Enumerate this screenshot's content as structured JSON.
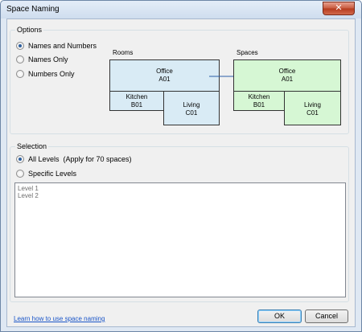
{
  "window": {
    "title": "Space Naming",
    "close_glyph": "✕"
  },
  "options": {
    "group_label": "Options",
    "radios": [
      {
        "label": "Names and Numbers",
        "checked": true
      },
      {
        "label": "Names Only",
        "checked": false
      },
      {
        "label": "Numbers Only",
        "checked": false
      }
    ]
  },
  "diagram": {
    "rooms_label": "Rooms",
    "spaces_label": "Spaces",
    "rooms": {
      "office": {
        "name": "Office",
        "number": "A01"
      },
      "kitchen": {
        "name": "Kitchen",
        "number": "B01"
      },
      "living": {
        "name": "Living",
        "number": "C01"
      }
    },
    "spaces": {
      "office": {
        "name": "Office",
        "number": "A01"
      },
      "kitchen": {
        "name": "Kitchen",
        "number": "B01"
      },
      "living": {
        "name": "Living",
        "number": "C01"
      }
    },
    "colors": {
      "room_fill": "#d9ebf5",
      "space_fill": "#d6f7d4",
      "arrow": "#2a5ea8"
    }
  },
  "selection": {
    "group_label": "Selection",
    "radios": [
      {
        "label": "All Levels  (Apply for 70 spaces)",
        "checked": true
      },
      {
        "label": "Specific Levels",
        "checked": false
      }
    ],
    "levels": [
      "Level 1",
      "Level 2"
    ]
  },
  "footer": {
    "help_link": "Learn how to use space naming",
    "ok_label": "OK",
    "cancel_label": "Cancel"
  }
}
